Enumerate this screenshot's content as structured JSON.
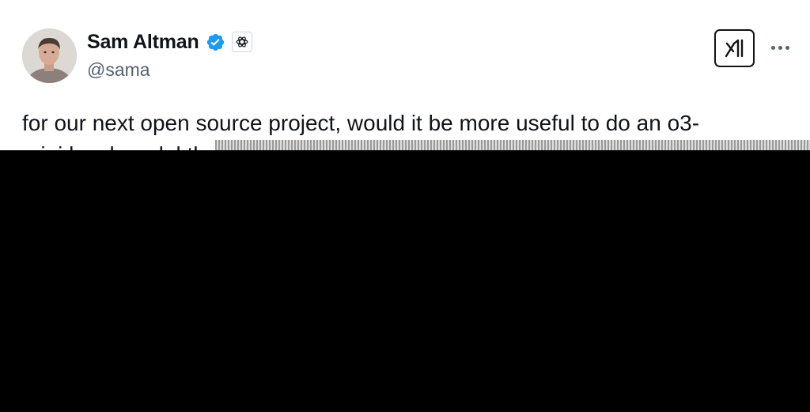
{
  "author": {
    "display_name": "Sam Altman",
    "handle": "@sama",
    "verified": true,
    "verified_icon": "verified-badge-icon",
    "affiliation_icon": "openai-logo-icon",
    "verified_color": "#1d9bf0"
  },
  "header": {
    "logo_icon": "x-logo-icon",
    "more_icon": "more-options-icon"
  },
  "tweet": {
    "text_line_1": "for our next open source project, would it be more useful to do an o3-",
    "text_line_2_visible": "mini level model th"
  }
}
